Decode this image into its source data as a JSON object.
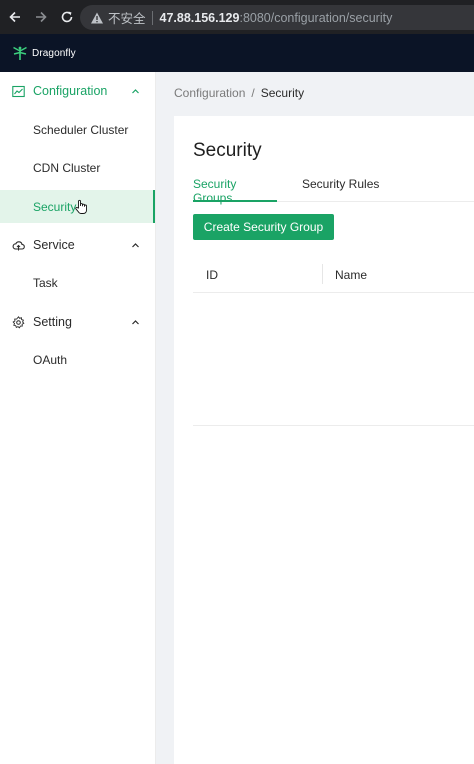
{
  "browser": {
    "insecure_label": "不安全",
    "url_host": "47.88.156.129",
    "url_path": ":8080/configuration/security"
  },
  "app": {
    "brand": "Dragonfly",
    "header_bg": "#0b1426",
    "accent": "#1aa365"
  },
  "sidebar": {
    "groups": [
      {
        "label": "Configuration",
        "icon": "line-chart-icon",
        "expanded": true,
        "active": true,
        "items": [
          {
            "label": "Scheduler Cluster",
            "selected": false
          },
          {
            "label": "CDN Cluster",
            "selected": false
          },
          {
            "label": "Security",
            "selected": true
          }
        ]
      },
      {
        "label": "Service",
        "icon": "cloud-icon",
        "expanded": true,
        "active": false,
        "items": [
          {
            "label": "Task",
            "selected": false
          }
        ]
      },
      {
        "label": "Setting",
        "icon": "gear-icon",
        "expanded": true,
        "active": false,
        "items": [
          {
            "label": "OAuth",
            "selected": false
          }
        ]
      }
    ]
  },
  "breadcrumb": {
    "parent": "Configuration",
    "separator": "/",
    "current": "Security"
  },
  "page": {
    "title": "Security",
    "tabs": [
      {
        "label": "Security Groups",
        "active": true
      },
      {
        "label": "Security Rules",
        "active": false
      }
    ],
    "create_button": "Create Security Group",
    "table": {
      "columns": [
        "ID",
        "Name"
      ],
      "rows": []
    }
  }
}
